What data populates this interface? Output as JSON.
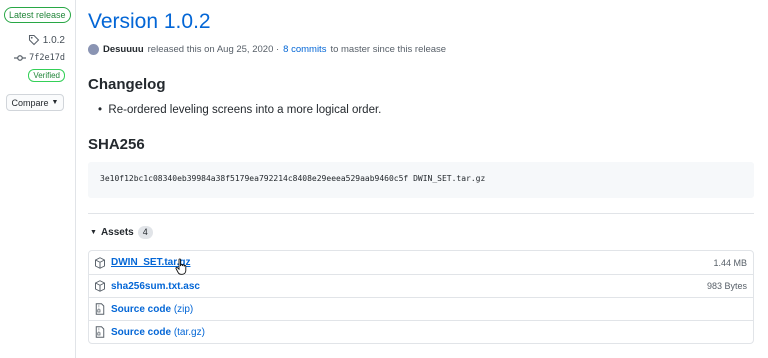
{
  "sidebar": {
    "latest_badge": "Latest release",
    "tag": "1.0.2",
    "commit": "7f2e17d",
    "verified": "Verified",
    "compare": "Compare"
  },
  "release": {
    "title": "Version 1.0.2",
    "author": "Desuuuu",
    "released_text": "released this on Aug 25, 2020 ·",
    "commits_link": "8 commits",
    "commits_suffix": "to master since this release"
  },
  "changelog": {
    "heading": "Changelog",
    "items": [
      "Re-ordered leveling screens into a more logical order."
    ]
  },
  "sha": {
    "heading": "SHA256",
    "code": "3e10f12bc1c08340eb39984a38f5179ea792214c8408e29eeea529aab9460c5f  DWIN_SET.tar.gz"
  },
  "assets": {
    "label": "Assets",
    "count": "4",
    "rows": [
      {
        "name": "DWIN_SET.tar.gz",
        "size": "1.44 MB"
      },
      {
        "name": "sha256sum.txt.asc",
        "size": "983 Bytes"
      },
      {
        "name": "Source code",
        "paren": "(zip)"
      },
      {
        "name": "Source code",
        "paren": "(tar.gz)"
      }
    ]
  }
}
